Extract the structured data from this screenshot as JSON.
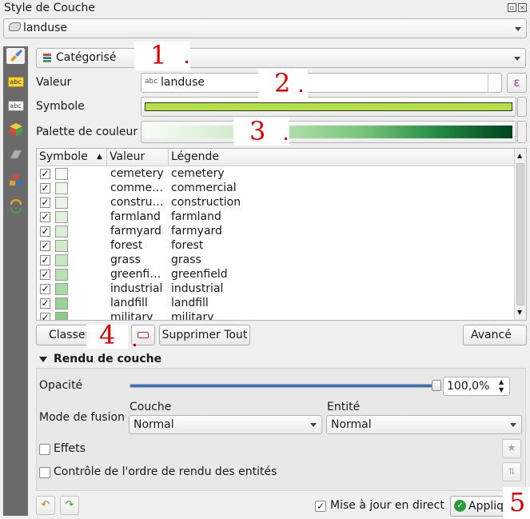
{
  "window": {
    "title": "Style de Couche"
  },
  "layer": {
    "name": "landuse"
  },
  "renderer": {
    "type": "Catégorisé"
  },
  "fields": {
    "value_label": "Valeur",
    "value": "landuse",
    "value_type_badge": "abc",
    "expression_btn": "ε",
    "symbol_label": "Symbole",
    "palette_label": "Palette de couleur"
  },
  "colors": {
    "symbol": "#b5e048",
    "palette_start": "#f7fcf5",
    "palette_end": "#00441b",
    "annotation": "#e00000"
  },
  "annotations": [
    "1",
    "2",
    "3",
    "4",
    "5"
  ],
  "table": {
    "headers": [
      "Symbole",
      "Valeur",
      "Légende"
    ],
    "rows": [
      {
        "value": "cemetery",
        "legend": "cemetery",
        "color": "#f4fbf2"
      },
      {
        "value": "comme…",
        "legend": "commercial",
        "color": "#eef8ea"
      },
      {
        "value": "constru…",
        "legend": "construction",
        "color": "#e8f5e3"
      },
      {
        "value": "farmland",
        "legend": "farmland",
        "color": "#e1f2dc"
      },
      {
        "value": "farmyard",
        "legend": "farmyard",
        "color": "#d9efd3"
      },
      {
        "value": "forest",
        "legend": "forest",
        "color": "#cfebc9"
      },
      {
        "value": "grass",
        "legend": "grass",
        "color": "#c5e7bf"
      },
      {
        "value": "greenfi…",
        "legend": "greenfield",
        "color": "#b7e1b1"
      },
      {
        "value": "industrial",
        "legend": "industrial",
        "color": "#a8daa2"
      },
      {
        "value": "landfill",
        "legend": "landfill",
        "color": "#98d294"
      },
      {
        "value": "military",
        "legend": "military",
        "color": "#88ca86"
      }
    ]
  },
  "buttons": {
    "classify": "Classer",
    "delete_all": "Supprimer Tout",
    "advanced": "Avancé",
    "apply": "Appliq"
  },
  "layer_rendering": {
    "title": "Rendu de couche",
    "opacity_label": "Opacité",
    "opacity_value": "100,0%",
    "opacity_fraction": 1.0,
    "blend_label": "Mode de fusion",
    "layer_col": "Couche",
    "feature_col": "Entité",
    "layer_blend": "Normal",
    "feature_blend": "Normal",
    "effects_label": "Effets",
    "order_label": "Contrôle de l'ordre de rendu des entités"
  },
  "footer": {
    "live_update_label": "Mise à jour en direct"
  },
  "check_mark": "✓"
}
